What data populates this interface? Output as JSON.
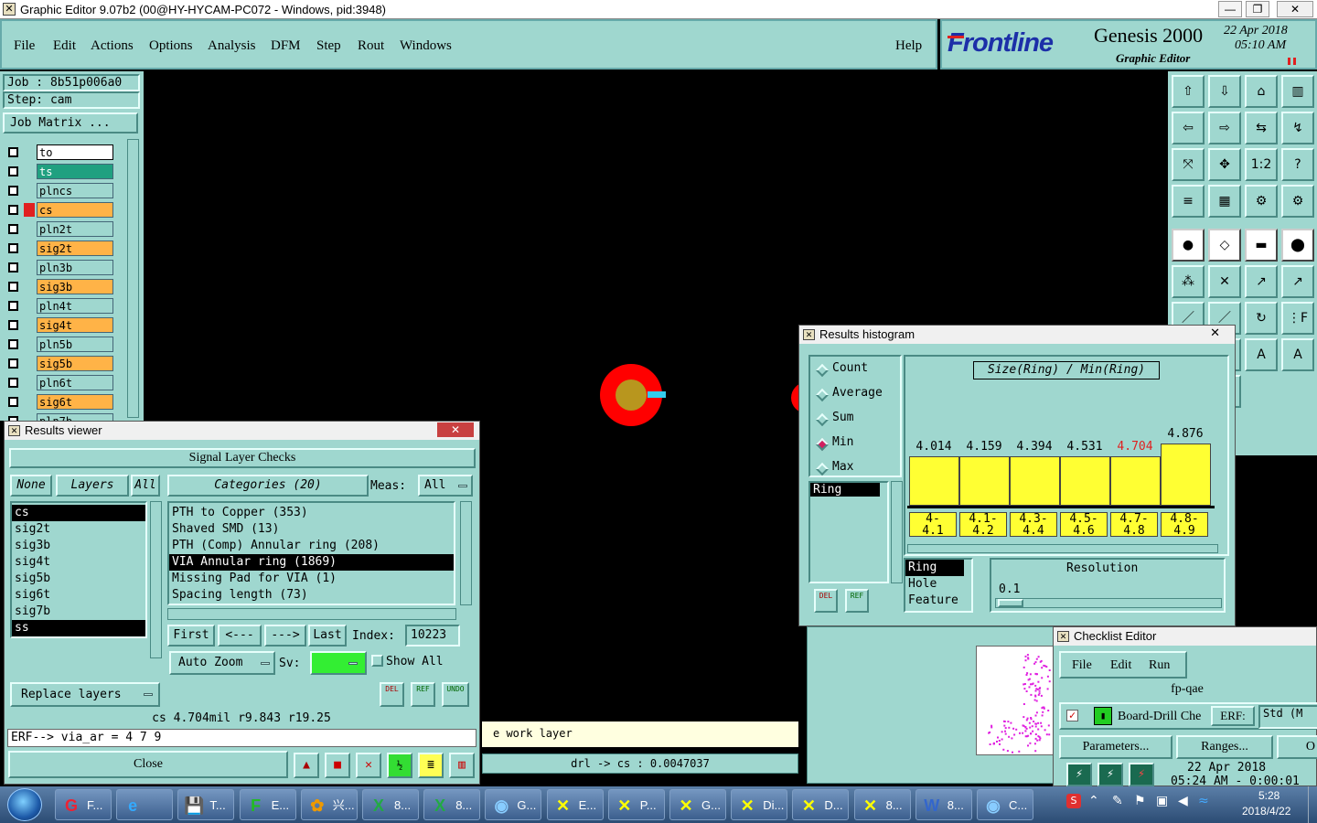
{
  "window": {
    "title": "Graphic Editor 9.07b2 (00@HY-HYCAM-PC072 - Windows, pid:3948)",
    "min": "—",
    "max": "❐",
    "close": "✕"
  },
  "menu": {
    "items": [
      "File",
      "Edit",
      "Actions",
      "Options",
      "Analysis",
      "DFM",
      "Step",
      "Rout",
      "Windows"
    ],
    "help": "Help"
  },
  "brand": {
    "logo": "Frontline",
    "product": "Genesis 2000",
    "subtitle": "Graphic Editor",
    "date": "22 Apr 2018",
    "time": "05:10 AM"
  },
  "job": {
    "job_label": "Job : 8b51p006a0",
    "step_label": "Step: cam",
    "matrix_button": "Job Matrix ..."
  },
  "layers": [
    {
      "name": "to",
      "color": "#ffffff"
    },
    {
      "name": "ts",
      "color": "#20a080"
    },
    {
      "name": "plncs",
      "color": "#9fd7cf"
    },
    {
      "name": "cs",
      "color": "#ffb347"
    },
    {
      "name": "pln2t",
      "color": "#9fd7cf"
    },
    {
      "name": "sig2t",
      "color": "#ffb347"
    },
    {
      "name": "pln3b",
      "color": "#9fd7cf"
    },
    {
      "name": "sig3b",
      "color": "#ffb347"
    },
    {
      "name": "pln4t",
      "color": "#9fd7cf"
    },
    {
      "name": "sig4t",
      "color": "#ffb347"
    },
    {
      "name": "pln5b",
      "color": "#9fd7cf"
    },
    {
      "name": "sig5b",
      "color": "#ffb347"
    },
    {
      "name": "pln6t",
      "color": "#9fd7cf"
    },
    {
      "name": "sig6t",
      "color": "#ffb347"
    },
    {
      "name": "pln7b",
      "color": "#9fd7cf"
    }
  ],
  "results_viewer": {
    "title": "Results viewer",
    "header": "Signal Layer Checks",
    "none": "None",
    "layers": "Layers",
    "all": "All",
    "categories_label": "Categories (20)",
    "meas_label": "Meas:",
    "meas_value": "All",
    "layer_list": [
      "cs",
      "sig2t",
      "sig3b",
      "sig4t",
      "sig5b",
      "sig6t",
      "sig7b",
      "ss"
    ],
    "category_list": [
      "PTH to Copper (353)",
      "Shaved SMD (13)",
      "PTH (Comp) Annular ring (208)",
      "VIA Annular ring (1869)",
      "Missing Pad for VIA (1)",
      "Spacing length (73)"
    ],
    "first": "First",
    "prev": "<---",
    "next": "--->",
    "last": "Last",
    "index_label": "Index:",
    "index_value": "10223",
    "auto_zoom": "Auto Zoom",
    "sv_label": "Sv:",
    "show_all": "Show All",
    "replace_layers": "Replace layers",
    "del": "DEL",
    "ref": "REF",
    "undo": "UNDO",
    "measure_readout": "cs 4.704mil  r9.843  r19.25",
    "erf_line": "ERF--> via_ar = 4 7 9",
    "close": "Close"
  },
  "status": {
    "work_layer": "e work layer",
    "drl": "drl -> cs : 0.0047037"
  },
  "histogram": {
    "title": "Results histogram",
    "modes": [
      "Count",
      "Average",
      "Sum",
      "Min",
      "Max"
    ],
    "selected_mode": "Min",
    "metric_list": [
      "Ring"
    ],
    "chart_title": "Size(Ring) / Min(Ring)",
    "values": [
      "4.014",
      "4.159",
      "4.394",
      "4.531",
      "4.704",
      "4.876"
    ],
    "ranges": [
      "4-\n4.1",
      "4.1-\n4.2",
      "4.3-\n4.4",
      "4.5-\n4.6",
      "4.7-\n4.8",
      "4.8-\n4.9"
    ],
    "highlight_index": 4,
    "fields": [
      "Ring",
      "Hole",
      "Feature"
    ],
    "resolution_label": "Resolution",
    "resolution_value": "0.1",
    "del": "DEL",
    "ref": "REF"
  },
  "checklist": {
    "title": "Checklist Editor",
    "menu": [
      "File",
      "Edit",
      "Run"
    ],
    "name": "fp-qae",
    "row_text": "Board-Drill Che",
    "erf_label": "ERF:",
    "erf_value": "Std (M",
    "parameters": "Parameters...",
    "ranges": "Ranges...",
    "other": "O",
    "date": "22 Apr 2018",
    "time": "05:24 AM - 0:00:01"
  },
  "taskbar": {
    "tasks": [
      "F...",
      "",
      "T...",
      "E...",
      "兴...",
      "8...",
      "8...",
      "G...",
      "E...",
      "P...",
      "G...",
      "Di...",
      "D...",
      "8...",
      "8...",
      "C..."
    ],
    "clock_time": "5:28",
    "clock_date": "2018/4/22"
  },
  "colors": {
    "teal": "#9fd7cf",
    "pad_outer": "#ff0000",
    "pad_inner": "#b8961e",
    "highlight_red": "#e02020",
    "bar_yellow": "#ffff33"
  }
}
